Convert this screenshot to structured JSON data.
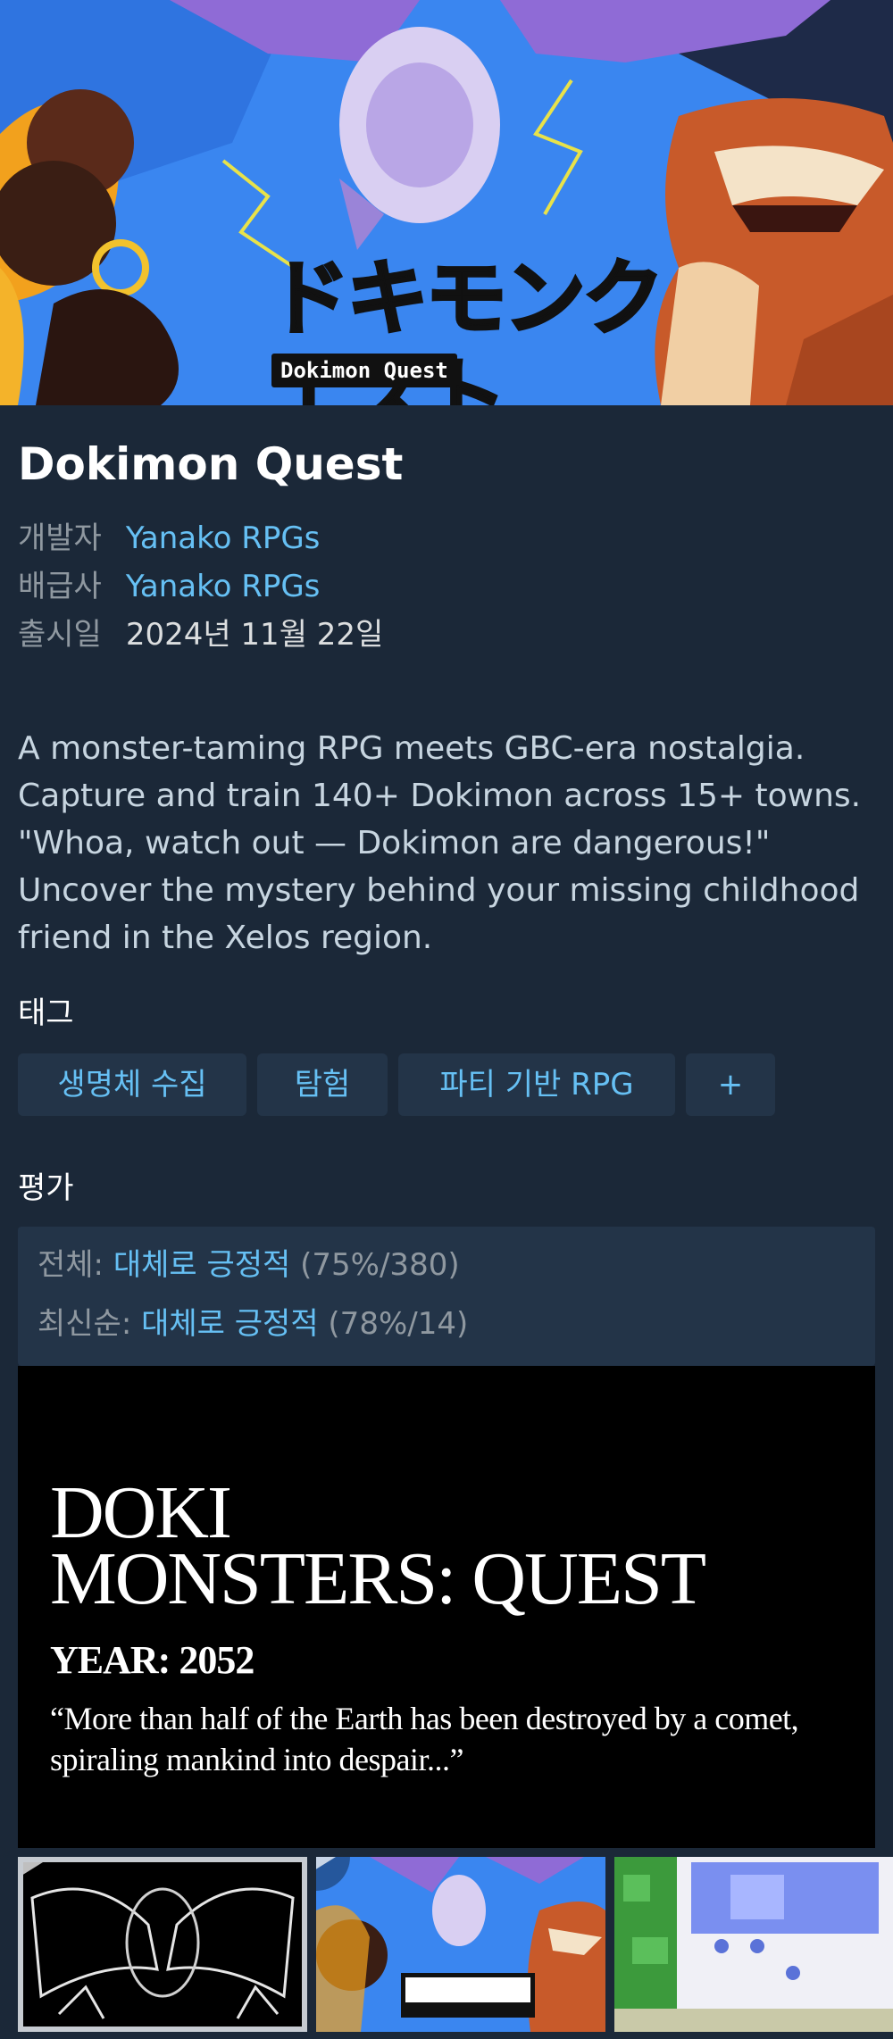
{
  "hero": {
    "logo_jp": "ドキモンクエスト",
    "logo_en": "Dokimon Quest"
  },
  "game": {
    "title": "Dokimon Quest",
    "developer_label": "개발자",
    "developer": "Yanako RPGs",
    "publisher_label": "배급사",
    "publisher": "Yanako RPGs",
    "release_label": "출시일",
    "release_date": "2024년 11월 22일",
    "description": "A monster-taming RPG meets GBC-era nostalgia. Capture and train 140+ Dokimon across 15+ towns. \"Whoa, watch out — Dokimon are dangerous!\" Uncover the mystery behind your missing childhood friend in the Xelos region."
  },
  "tags": {
    "label": "태그",
    "items": [
      "생명체 수집",
      "탐험",
      "파티 기반 RPG",
      "+"
    ]
  },
  "reviews": {
    "label": "평가",
    "overall_label": "전체:",
    "overall_summary": "대체로 긍정적",
    "overall_detail": "(75%/380)",
    "recent_label": "최신순:",
    "recent_summary": "대체로 긍정적",
    "recent_detail": "(78%/14)"
  },
  "media": {
    "main_title": "DOKI\nMONSTERS: QUEST",
    "main_year": "YEAR: 2052",
    "main_quote": "“More than half of the Earth has been destroyed by a comet, spiraling mankind into despair...”",
    "thumbnails": [
      {
        "kind": "video",
        "icon": "play-icon",
        "selected": true
      },
      {
        "kind": "video",
        "icon": "play-icon",
        "selected": false
      },
      {
        "kind": "image",
        "selected": false
      }
    ]
  },
  "colors": {
    "background": "#1b2838",
    "link": "#66c0f4",
    "tag_bg": "#233448",
    "muted": "#8f98a0"
  }
}
